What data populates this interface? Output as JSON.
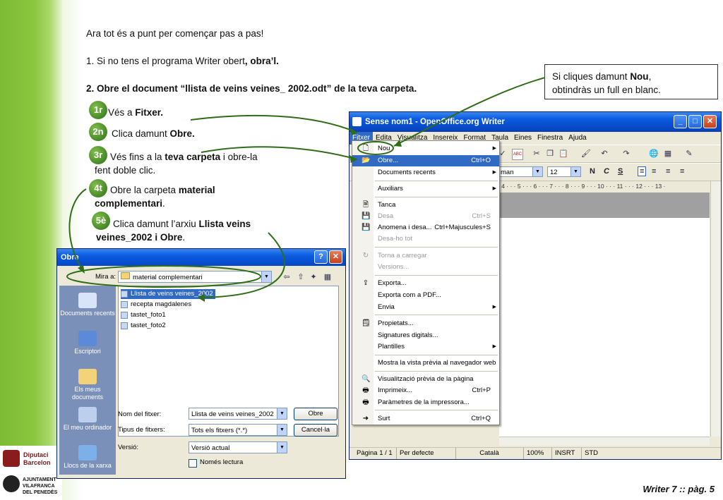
{
  "slide": {
    "intro": "Ara tot és a punt per començar pas a pas!",
    "step1_prefix": "1. Si no tens el programa Writer obert",
    "step1_bold": ", obra’l.",
    "step2": "2. Obre el document “llista de veins veines_ 2002.odt” de la teva carpeta.",
    "steps": [
      {
        "badge": "1r",
        "text": "Vés a ",
        "bold": "Fitxer."
      },
      {
        "badge": "2n",
        "text": "Clica damunt ",
        "bold": "Obre."
      },
      {
        "badge": "3r",
        "text": "Vés fins a la ",
        "bold": "teva carpeta",
        "rest": " i obre-la",
        "line2": "fent doble clic."
      },
      {
        "badge": "4t",
        "text": "Obre la carpeta ",
        "bold": "material",
        "line2_bold": "complementari",
        "line2_rest": "."
      },
      {
        "badge": "5è",
        "text": "Clica damunt l’arxiu ",
        "bold": "Llista veins",
        "line2_bold": "veines_2002 i Obre",
        "line2_rest": "."
      }
    ],
    "callout_line1_prefix": "Si cliques damunt ",
    "callout_line1_bold": "Nou",
    "callout_line1_suffix": ",",
    "callout_line2": "obtindràs un full en blanc.",
    "footer": "Writer 7 :: pàg. 5"
  },
  "logos": {
    "diputacio1": "Diputaci",
    "diputacio2": "Barcelon",
    "ajuntament1": "AJUNTAMENT",
    "ajuntament2": "VILAFRANCA",
    "ajuntament3": "DEL PENEDÈS"
  },
  "writer": {
    "title": "Sense nom1 - OpenOffice.org Writer",
    "menus": [
      "Fitxer",
      "Edita",
      "Visualitza",
      "Insereix",
      "Format",
      "Taula",
      "Eines",
      "Finestra",
      "Ajuda"
    ],
    "font_name": "man",
    "font_size": "12",
    "ruler": "· 4 · · · 5 · · · 6 · · · 7 · · · 8 · · · 9 · · · 10 · · · 11 · · · 12 · · · 13 ·",
    "status": {
      "page": "Pàgina 1 / 1",
      "style": "Per defecte",
      "lang": "Català",
      "zoom": "100%",
      "mode": "INSRT",
      "std": "STD"
    }
  },
  "file_menu": {
    "items": [
      {
        "label": "Nou",
        "icon": "new-doc-icon",
        "arrow": true
      },
      {
        "label": "Obre...",
        "shortcut": "Ctrl+O",
        "icon": "open-folder-icon",
        "highlighted": true
      },
      {
        "label": "Documents recents",
        "arrow": true
      },
      {
        "label": "Auxiliars",
        "arrow": true
      },
      {
        "label": "Tanca",
        "icon": "close-doc-icon"
      },
      {
        "label": "Desa",
        "shortcut": "Ctrl+S",
        "disabled": true,
        "icon": "save-icon"
      },
      {
        "label": "Anomena i desa...",
        "shortcut": "Ctrl+Majuscules+S",
        "icon": "save-as-icon"
      },
      {
        "label": "Desa-ho tot",
        "disabled": true
      },
      {
        "label": "Torna a carregar",
        "disabled": true,
        "icon": "reload-icon"
      },
      {
        "label": "Versions...",
        "disabled": true
      },
      {
        "label": "Exporta...",
        "icon": "export-icon"
      },
      {
        "label": "Exporta com a PDF...",
        "icon": "pdf-icon"
      },
      {
        "label": "Envia",
        "arrow": true
      },
      {
        "label": "Propietats...",
        "icon": "properties-icon"
      },
      {
        "label": "Signatures digitals..."
      },
      {
        "label": "Plantilles",
        "arrow": true
      },
      {
        "label": "Mostra la vista prèvia al navegador web"
      },
      {
        "label": "Visualització prèvia de la pàgina",
        "icon": "preview-icon"
      },
      {
        "label": "Imprimeix...",
        "shortcut": "Ctrl+P",
        "icon": "print-icon"
      },
      {
        "label": "Paràmetres de la impressora...",
        "icon": "printer-settings-icon"
      },
      {
        "label": "Surt",
        "shortcut": "Ctrl+Q",
        "icon": "exit-icon"
      }
    ]
  },
  "open_dialog": {
    "title": "Obre",
    "look_in_label": "Mira a:",
    "look_in_value": "material complementari",
    "places": [
      "Documents recents",
      "Escriptori",
      "Els meus documents",
      "El meu ordinador",
      "Llocs de la xarxa"
    ],
    "files": [
      "Llista de veins veines_2002",
      "recepta magdalenes",
      "tastet_foto1",
      "tastet_foto2"
    ],
    "filename_label": "Nom del fitxer:",
    "filename_value": "Llista de veins veines_2002",
    "filetype_label": "Tipus de fitxers:",
    "filetype_value": "Tots els fitxers (*.*)",
    "version_label": "Versió:",
    "version_value": "Versió actual",
    "readonly_label": "Només lectura",
    "open_button": "Obre",
    "cancel_button": "Cancel·la"
  },
  "colors": {
    "band": "#8cc63f",
    "badge": "#3f8a22",
    "xp_title": "#0a5be0",
    "highlight": "#316ac5"
  }
}
